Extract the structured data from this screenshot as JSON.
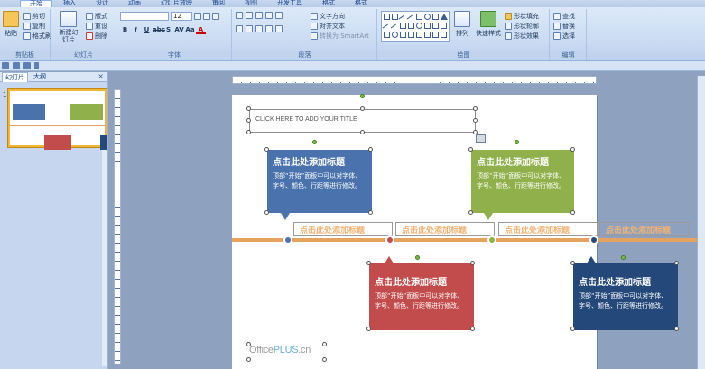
{
  "ribbon": {
    "tabs": [
      "开始",
      "插入",
      "设计",
      "动画",
      "幻灯片放映",
      "审阅",
      "视图",
      "开发工具",
      "格式",
      "格式"
    ],
    "clipboard": {
      "paste": "粘贴",
      "cut": "剪切",
      "copy": "复制",
      "format_painter": "格式刷",
      "label": "剪贴板"
    },
    "slides": {
      "new_slide": "新建幻灯片",
      "layout": "版式",
      "reset": "重设",
      "delete": "删除",
      "label": "幻灯片"
    },
    "font": {
      "font_name": "",
      "font_size": "12",
      "label": "字体"
    },
    "paragraph": {
      "text_direction": "文字方向",
      "align_text": "对齐文本",
      "smartart": "转换为 SmartArt",
      "label": "段落"
    },
    "drawing": {
      "arrange": "排列",
      "quick_styles": "快速样式",
      "shape_fill": "形状填充",
      "shape_outline": "形状轮廓",
      "shape_effects": "形状效果",
      "label": "绘图"
    },
    "editing": {
      "find": "查找",
      "replace": "替换",
      "select": "选择",
      "label": "编辑"
    }
  },
  "leftpane": {
    "tab_slides": "幻灯片",
    "tab_outline": "大纲",
    "slide_number": "1",
    "close": "×"
  },
  "slide": {
    "title_placeholder": "CLICK HERE TO ADD YOUR TITLE",
    "cards": [
      {
        "title": "点击此处添加标题",
        "body": "顶部“开始”面板中可以对字体、字号、颜色、行距等进行修改。",
        "color": "#4a72ac"
      },
      {
        "title": "点击此处添加标题",
        "body": "顶部“开始”面板中可以对字体、字号、颜色、行距等进行修改。",
        "color": "#8fb04a"
      },
      {
        "title": "点击此处添加标题",
        "body": "顶部“开始”面板中可以对字体、字号、颜色、行距等进行修改。",
        "color": "#c24b4b"
      },
      {
        "title": "点击此处添加标题",
        "body": "顶部“开始”面板中可以对字体、字号、颜色、行距等进行修改。",
        "color": "#24487a"
      }
    ],
    "timeline_labels": [
      "点击此处添加标题",
      "点击此处添加标题",
      "点击此处添加标题",
      "点击此处添加标题"
    ],
    "brand_office": "Office",
    "brand_plus": "PLUS",
    "brand_cn": ".cn",
    "accent_color": "#e4a460"
  }
}
